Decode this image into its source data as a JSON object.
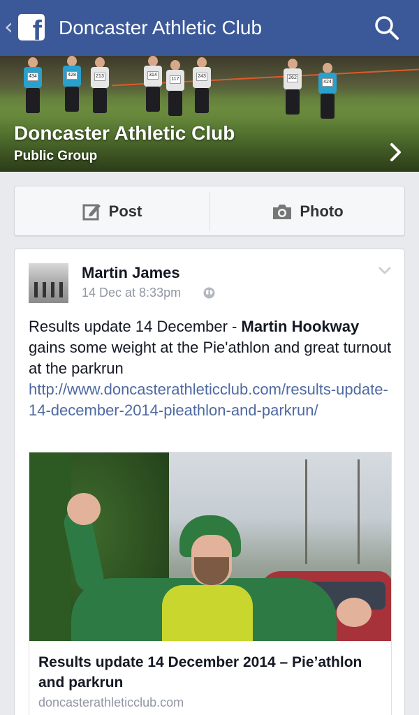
{
  "header": {
    "title": "Doncaster Athletic Club",
    "logo_letter": "f",
    "back_glyph": "‹"
  },
  "cover": {
    "group_name": "Doncaster Athletic Club",
    "group_type": "Public Group",
    "bibs": [
      "434",
      "428",
      "213",
      "314",
      "117",
      "243",
      "262",
      "424"
    ]
  },
  "composer": {
    "post_label": "Post",
    "photo_label": "Photo"
  },
  "post": {
    "author": "Martin James",
    "timestamp": "14 Dec at 8:33pm",
    "text_prefix": "Results update 14 December - ",
    "text_bold": "Martin Hookway",
    "text_suffix": " gains some weight at the Pie'athlon and great turnout at the parkrun ",
    "link_text": "http://www.doncasterathleticclub.com/results-update-14-december-2014-pieathlon-and-parkrun/",
    "link_card": {
      "title": "Results update 14 December 2014 – Pie’athlon and parkrun",
      "domain": "doncasterathleticclub.com"
    }
  },
  "colors": {
    "brand": "#3b5998",
    "link": "#4e69a2",
    "meta": "#9197a3",
    "background": "#e9eaed"
  },
  "icons": [
    "back-chevron-icon",
    "facebook-logo-icon",
    "search-icon",
    "chevron-right-icon",
    "edit-post-icon",
    "camera-icon",
    "globe-icon",
    "caret-down-icon"
  ]
}
